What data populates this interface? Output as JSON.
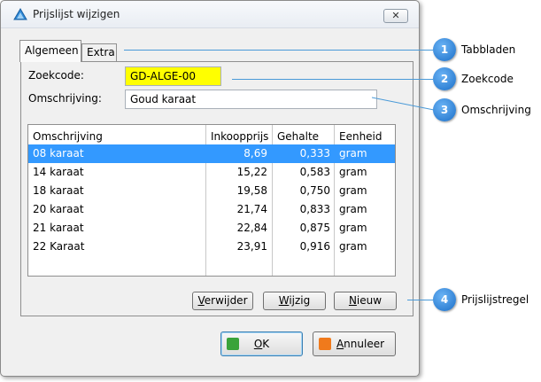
{
  "window": {
    "title": "Prijslijst wijzigen",
    "close_glyph": "✕"
  },
  "tabs": [
    {
      "label": "Algemeen",
      "active": true
    },
    {
      "label": "Extra",
      "active": false
    }
  ],
  "form": {
    "zoekcode_label": "Zoekcode:",
    "zoekcode_value": "GD-ALGE-00",
    "zoekcode_bg": "#ffff00",
    "omschrijving_label": "Omschrijving:",
    "omschrijving_value": "Goud karaat"
  },
  "grid": {
    "headers": [
      "Omschrijving",
      "Inkoopprijs",
      "Gehalte",
      "Eenheid"
    ],
    "selected_row": 0,
    "selection_color": "#3399ff",
    "rows": [
      [
        "08 karaat",
        "8,69",
        "0,333",
        "gram"
      ],
      [
        "14 karaat",
        "15,22",
        "0,583",
        "gram"
      ],
      [
        "18 karaat",
        "19,58",
        "0,750",
        "gram"
      ],
      [
        "20 karaat",
        "21,74",
        "0,833",
        "gram"
      ],
      [
        "21 karaat",
        "22,84",
        "0,875",
        "gram"
      ],
      [
        "22 Karaat",
        "23,91",
        "0,916",
        "gram"
      ]
    ]
  },
  "row_buttons": {
    "verwijder": {
      "u": "V",
      "rest": "erwijder"
    },
    "wijzig": {
      "u": "W",
      "rest": "ijzig"
    },
    "nieuw": {
      "u": "N",
      "rest": "ieuw"
    }
  },
  "footer": {
    "ok": {
      "u": "O",
      "rest": "K",
      "icon": "thumbs-up-icon"
    },
    "annuleer": {
      "u": "A",
      "rest": "nnuleer",
      "icon": "thumbs-down-icon"
    }
  },
  "callouts": [
    {
      "number": "1",
      "text": "Tabbladen"
    },
    {
      "number": "2",
      "text": "Zoekcode"
    },
    {
      "number": "3",
      "text": "Omschrijving"
    },
    {
      "number": "4",
      "text": "Prijslijstregel"
    }
  ],
  "colors": {
    "callout": "#1b6fc8",
    "ok_icon": "#3aa33a",
    "cancel_icon": "#f07a1c"
  }
}
